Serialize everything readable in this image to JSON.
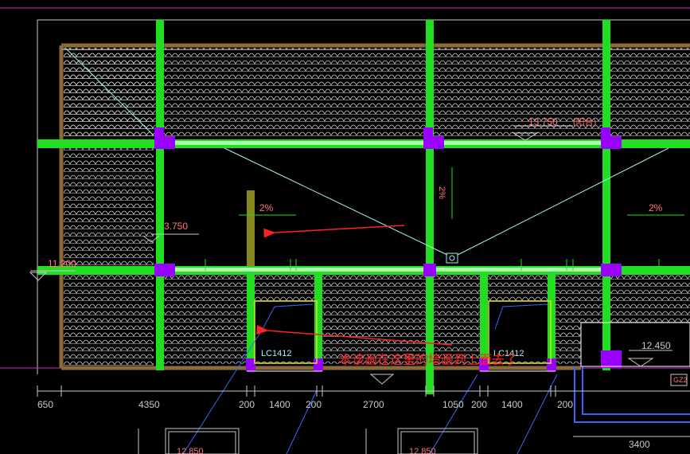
{
  "colors": {
    "background": "#000000",
    "wall": "#22dd22",
    "column": "#9900ff",
    "roof_hatch": "#cfcfcf",
    "frame": "#8a6a3a",
    "dimension": "#c8c8c8",
    "level_text": "#ff7777",
    "annotation_red": "#ff2222",
    "cyan": "#a8f0f0",
    "blue": "#3366ff",
    "yellow": "#dddd22",
    "olive": "#888822"
  },
  "levels": {
    "top_right": "13.750",
    "left_mid": "3.750",
    "left_outer": "11.200",
    "bottom_right": "12.450",
    "bottom_left": "12.850",
    "bottom_mid": "12.850"
  },
  "slopes": {
    "left": "2%",
    "center": "2%",
    "right": "2%"
  },
  "windows": {
    "left": "LC1412",
    "right": "LC1412"
  },
  "annotation": {
    "text": "本该画在这里的墙画到上面去了"
  },
  "tags": {
    "top_label": "(阳台)",
    "gz": "GZ2"
  },
  "dimensions": [
    "650",
    "4350",
    "200",
    "1400",
    "200",
    "2700",
    "1050",
    "200",
    "1400",
    "200"
  ],
  "lower_dimension": "3400"
}
